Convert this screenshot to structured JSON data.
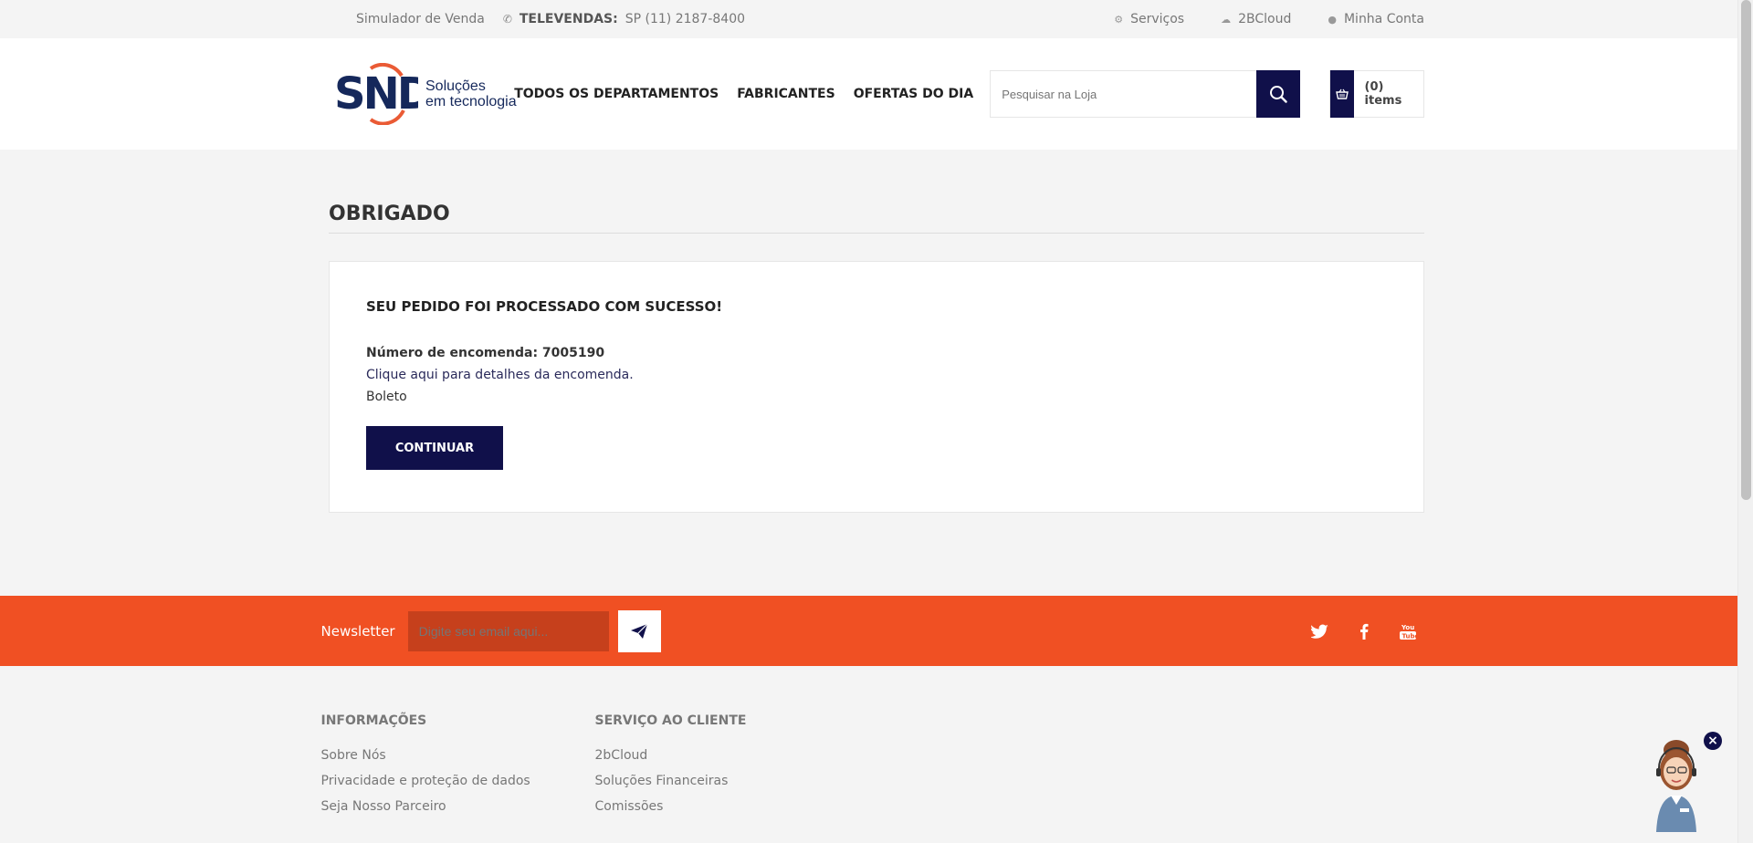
{
  "topbar": {
    "simulator": "Simulador de Venda",
    "tel_label": "TELEVENDAS:",
    "tel_number": "SP (11)  2187-8400",
    "services": "Serviços",
    "cloud": "2BCloud",
    "account": "Minha Conta"
  },
  "header": {
    "logo_main": "SND",
    "logo_sub_1": "Soluções",
    "logo_sub_2": "em tecnologia",
    "nav": [
      "TODOS OS DEPARTAMENTOS",
      "FABRICANTES",
      "OFERTAS DO DIA"
    ],
    "search_placeholder": "Pesquisar na Loja",
    "cart_count": "(0) items"
  },
  "main": {
    "title": "OBRIGADO",
    "success_heading": "SEU PEDIDO FOI PROCESSADO COM SUCESSO!",
    "order_number": "Número de encomenda: 7005190",
    "details_link": "Clique aqui para detalhes da encomenda.",
    "payment_method": "Boleto",
    "continue_label": "CONTINUAR"
  },
  "newsletter": {
    "label": "Newsletter",
    "placeholder": "Digite seu email aqui..."
  },
  "footer": {
    "col1_title": "INFORMAÇÕES",
    "col1_links": [
      "Sobre Nós",
      "Privacidade e proteção de dados",
      "Seja Nosso Parceiro"
    ],
    "col2_title": "SERVIÇO AO CLIENTE",
    "col2_links": [
      "2bCloud",
      "Soluções Financeiras",
      "Comissões"
    ]
  },
  "colors": {
    "primary": "#10104a",
    "accent": "#f05023",
    "brand_blue": "#15285b"
  }
}
